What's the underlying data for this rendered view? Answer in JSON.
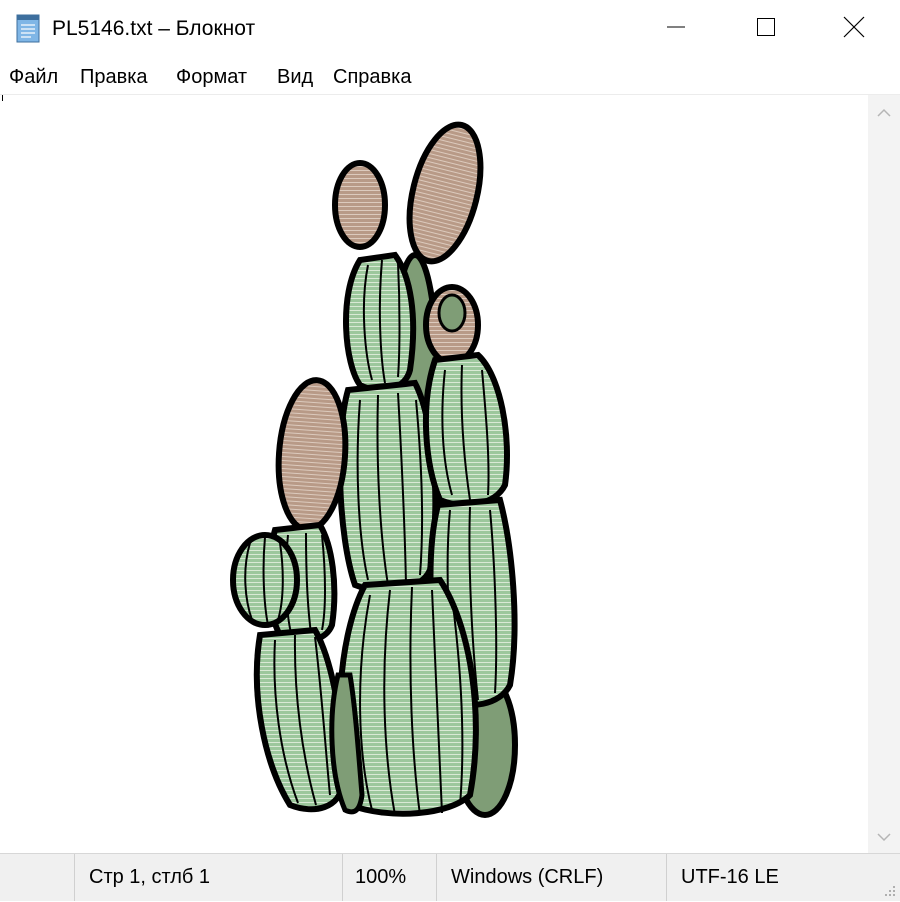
{
  "window": {
    "title": "PL5146.txt – Блокнот"
  },
  "icons": {
    "app": "notepad-icon",
    "minimize": "minimize-icon",
    "maximize": "maximize-icon",
    "close": "close-icon",
    "scroll_up": "chevron-up-icon",
    "scroll_down": "chevron-down-icon",
    "resize": "resize-grip-icon"
  },
  "menu": {
    "items": [
      {
        "label": "Файл"
      },
      {
        "label": "Правка"
      },
      {
        "label": "Формат"
      },
      {
        "label": "Вид"
      },
      {
        "label": "Справка"
      }
    ]
  },
  "content": {
    "image": "cactus-illustration"
  },
  "colors": {
    "cactus_green": "#9cc79c",
    "cactus_dark_green": "#7f9d76",
    "flower_tan": "#b89a87",
    "outline": "#000000"
  },
  "statusbar": {
    "position": "Стр 1, стлб 1",
    "zoom": "100%",
    "line_ending": "Windows (CRLF)",
    "encoding": "UTF-16 LE"
  }
}
